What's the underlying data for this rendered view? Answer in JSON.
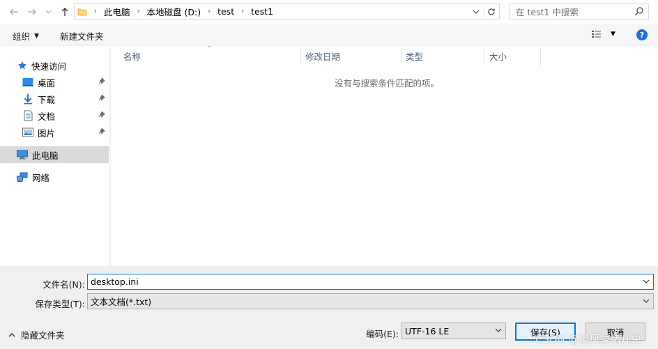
{
  "address": {
    "crumbs": [
      "此电脑",
      "本地磁盘 (D:)",
      "test",
      "test1"
    ]
  },
  "search": {
    "placeholder": "在 test1 中搜索"
  },
  "toolbar": {
    "organize": "组织",
    "new_folder": "新建文件夹"
  },
  "sidebar": {
    "quick_access": "快速访问",
    "items": [
      {
        "label": "桌面"
      },
      {
        "label": "下载"
      },
      {
        "label": "文档"
      },
      {
        "label": "图片"
      }
    ],
    "this_pc": "此电脑",
    "network": "网络"
  },
  "columns": [
    "名称",
    "修改日期",
    "类型",
    "大小"
  ],
  "empty_message": "没有与搜索条件匹配的项。",
  "bottom": {
    "filename_label": "文件名(N):",
    "filename_value": "desktop.ini",
    "filetype_label": "保存类型(T):",
    "filetype_value": "文本文档(*.txt)",
    "hide_folders": "隐藏文件夹",
    "encoding_label": "编码(E):",
    "encoding_value": "UTF-16 LE",
    "save": "保存(S)",
    "cancel": "取消"
  },
  "watermark": "CSDN @清风爱猪儿虫"
}
